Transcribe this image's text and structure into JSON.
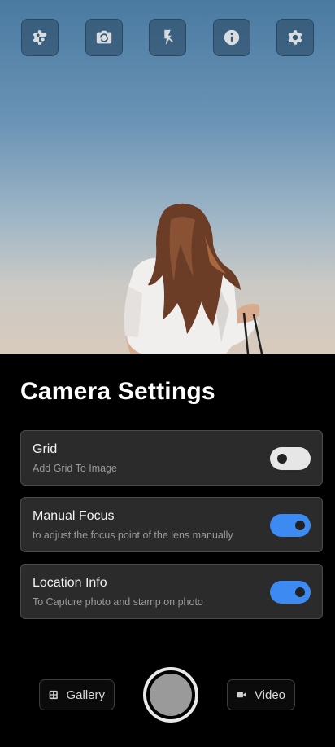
{
  "top_bar": {
    "buttons": [
      {
        "icon": "camera-gear-icon"
      },
      {
        "icon": "switch-camera-icon"
      },
      {
        "icon": "flash-off-icon"
      },
      {
        "icon": "info-icon"
      },
      {
        "icon": "settings-icon"
      }
    ]
  },
  "panel": {
    "title": "Camera Settings",
    "settings": [
      {
        "title": "Grid",
        "description": "Add Grid To Image",
        "enabled": false
      },
      {
        "title": "Manual Focus",
        "description": "to adjust the focus point of the lens manually",
        "enabled": true
      },
      {
        "title": "Location Info",
        "description": "To Capture photo and stamp on photo",
        "enabled": true
      }
    ]
  },
  "bottom": {
    "gallery_label": "Gallery",
    "video_label": "Video"
  },
  "colors": {
    "accent": "#3d8bf2",
    "card_bg": "#2b2b2b",
    "panel_bg": "#000000"
  }
}
